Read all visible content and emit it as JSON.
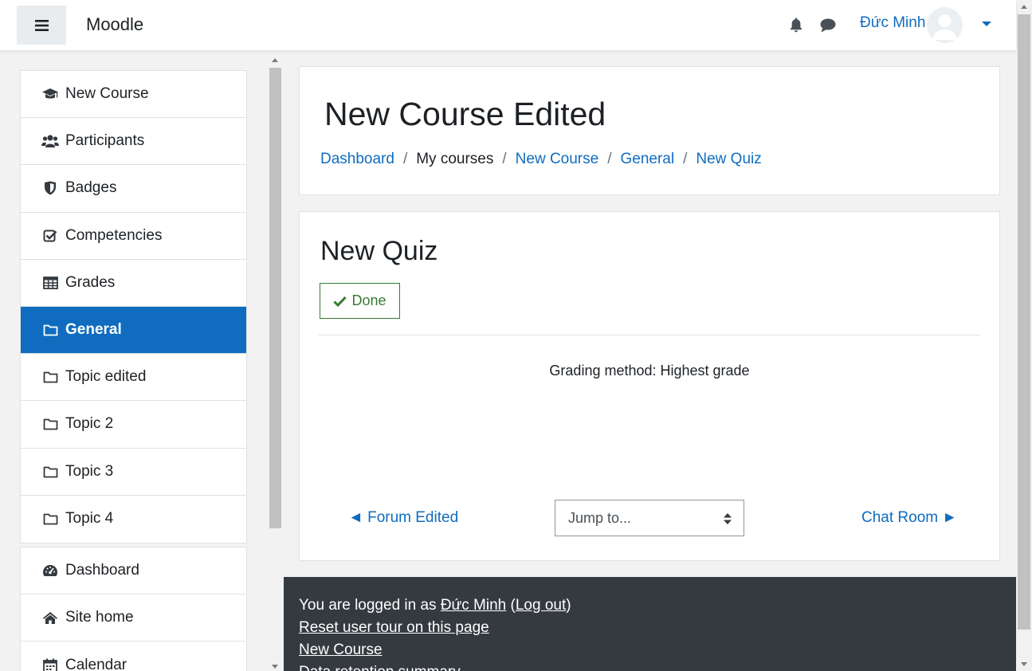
{
  "header": {
    "brand": "Moodle",
    "user_name": "Đức Minh"
  },
  "sidebar": {
    "course_items": [
      {
        "label": "New Course",
        "icon": "graduation-cap-icon"
      },
      {
        "label": "Participants",
        "icon": "users-icon"
      },
      {
        "label": "Badges",
        "icon": "shield-icon"
      },
      {
        "label": "Competencies",
        "icon": "check-square-icon"
      },
      {
        "label": "Grades",
        "icon": "table-icon"
      },
      {
        "label": "General",
        "icon": "folder-icon",
        "active": true
      },
      {
        "label": "Topic edited",
        "icon": "folder-icon"
      },
      {
        "label": "Topic 2",
        "icon": "folder-icon"
      },
      {
        "label": "Topic 3",
        "icon": "folder-icon"
      },
      {
        "label": "Topic 4",
        "icon": "folder-icon"
      }
    ],
    "site_items": [
      {
        "label": "Dashboard",
        "icon": "tachometer-icon"
      },
      {
        "label": "Site home",
        "icon": "home-icon"
      },
      {
        "label": "Calendar",
        "icon": "calendar-icon"
      }
    ]
  },
  "page_header": {
    "title": "New Course Edited",
    "breadcrumb": [
      "Dashboard",
      "My courses",
      "New Course",
      "General",
      "New Quiz"
    ]
  },
  "main": {
    "quiz_title": "New Quiz",
    "done_label": "Done",
    "grading_method": "Grading method: Highest grade",
    "prev_link": "◄ Forum Edited",
    "next_link": "Chat Room ►",
    "jump_placeholder": "Jump to..."
  },
  "footer": {
    "logged_in_prefix": "You are logged in as ",
    "user_link": "Đức Minh",
    "logout_open": " (",
    "logout_link": "Log out",
    "logout_close": ")",
    "links": [
      "Reset user tour on this page",
      "New Course",
      "Data retention summary"
    ]
  },
  "colors": {
    "primary": "#0f6cbf",
    "success": "#357a32",
    "footer_bg": "#343a40"
  }
}
